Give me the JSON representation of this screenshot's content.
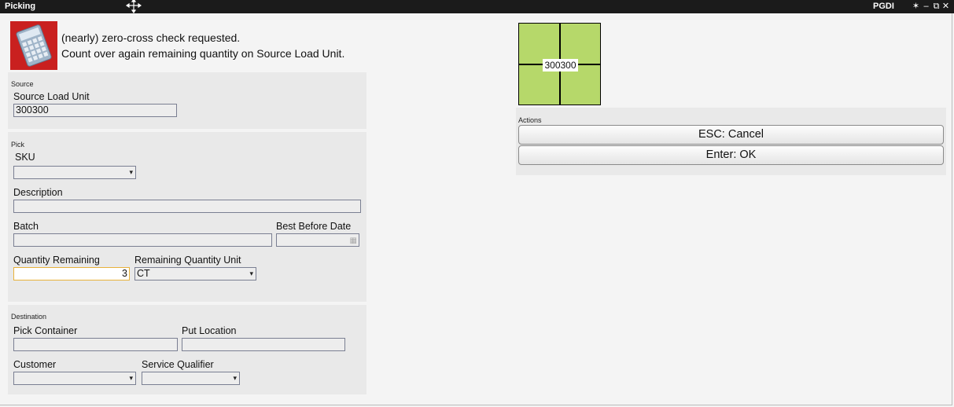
{
  "window": {
    "title": "Picking",
    "app_code": "PGDI",
    "controls": {
      "pin": "✶",
      "minimize": "–",
      "restore": "⧉",
      "close": "✕"
    }
  },
  "message": {
    "icon": "calculator-icon",
    "line1": "(nearly) zero-cross check requested.",
    "line2": "Count over again remaining quantity on Source Load Unit."
  },
  "source": {
    "group_label": "Source",
    "load_unit_label": "Source Load Unit",
    "load_unit_value": "300300"
  },
  "pick": {
    "group_label": "Pick",
    "sku_label": "SKU",
    "sku_value": "",
    "description_label": "Description",
    "description_value": "",
    "batch_label": "Batch",
    "batch_value": "",
    "best_before_label": "Best Before Date",
    "best_before_value": "",
    "qty_remaining_label": "Quantity Remaining",
    "qty_remaining_value": "3",
    "qty_unit_label": "Remaining Quantity Unit",
    "qty_unit_value": "CT"
  },
  "destination": {
    "group_label": "Destination",
    "pick_container_label": "Pick Container",
    "pick_container_value": "",
    "put_location_label": "Put Location",
    "put_location_value": "",
    "customer_label": "Customer",
    "customer_value": "",
    "service_qualifier_label": "Service Qualifier",
    "service_qualifier_value": ""
  },
  "load_unit_tile": {
    "code": "300300",
    "color": "#b6d86a"
  },
  "actions": {
    "group_label": "Actions",
    "cancel_label": "ESC: Cancel",
    "ok_label": "Enter: OK"
  },
  "colors": {
    "titlebar": "#1b1b1b",
    "panel": "#e9e9e9",
    "focus_border": "#e8b23a",
    "icon_bg": "#c9201f"
  }
}
